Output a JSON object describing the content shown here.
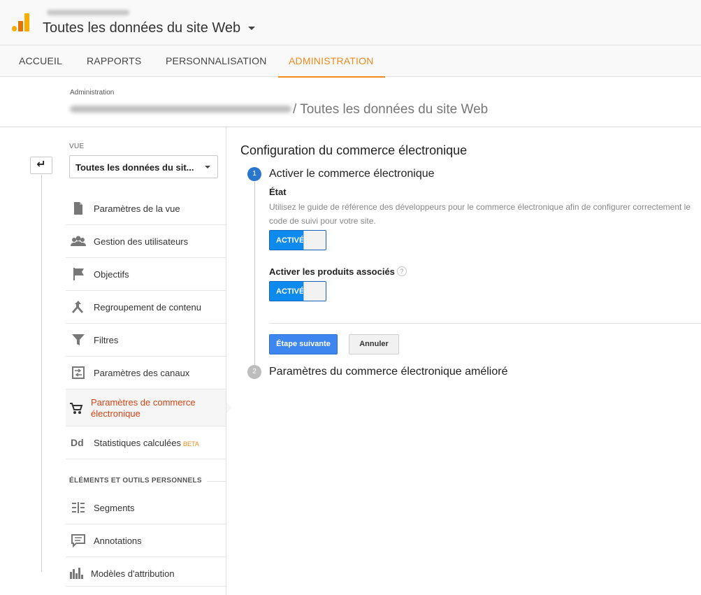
{
  "header": {
    "property_title": "Toutes les données du site Web"
  },
  "nav": {
    "tabs": [
      {
        "label": "ACCUEIL"
      },
      {
        "label": "RAPPORTS"
      },
      {
        "label": "PERSONNALISATION"
      },
      {
        "label": "ADMINISTRATION",
        "active": true
      }
    ]
  },
  "breadcrumb": {
    "label": "Administration",
    "title": "/ Toutes les données du site Web"
  },
  "sidebar": {
    "vue_label": "VUE",
    "view_select": "Toutes les données du sit...",
    "items": [
      {
        "label": "Paramètres de la vue",
        "icon": "document-icon"
      },
      {
        "label": "Gestion des utilisateurs",
        "icon": "users-icon"
      },
      {
        "label": "Objectifs",
        "icon": "flag-icon"
      },
      {
        "label": "Regroupement de contenu",
        "icon": "merge-icon"
      },
      {
        "label": "Filtres",
        "icon": "filter-icon"
      },
      {
        "label": "Paramètres des canaux",
        "icon": "channels-icon"
      },
      {
        "label": "Paramètres de commerce électronique",
        "icon": "cart-icon",
        "active": true
      },
      {
        "label": "Statistiques calculées",
        "icon": "calculated-icon",
        "badge": "BETA"
      }
    ],
    "section_label": "ÉLÉMENTS ET OUTILS PERSONNELS",
    "personal_items": [
      {
        "label": "Segments",
        "icon": "segments-icon"
      },
      {
        "label": "Annotations",
        "icon": "annotations-icon"
      },
      {
        "label": "Modèles d'attribution",
        "icon": "attribution-icon"
      }
    ]
  },
  "main": {
    "title": "Configuration du commerce électronique",
    "step1": {
      "number": "1",
      "title": "Activer le commerce électronique",
      "state_label": "État",
      "state_description": "Utilisez le guide de référence des développeurs pour le commerce électronique afin de configurer correctement le code de suivi pour votre site.",
      "toggle1_label": "ACTIVÉ",
      "assoc_label": "Activer les produits associés",
      "help_glyph": "?",
      "toggle2_label": "ACTIVÉ",
      "next_button": "Étape suivante",
      "cancel_button": "Annuler"
    },
    "step2": {
      "number": "2",
      "title": "Paramètres du commerce électronique amélioré"
    }
  },
  "colors": {
    "accent": "#f08a1c",
    "active_item": "#d84315",
    "toggle_on": "#0d8aee",
    "primary_button": "#3d86f0",
    "step_active": "#2a76cd"
  }
}
